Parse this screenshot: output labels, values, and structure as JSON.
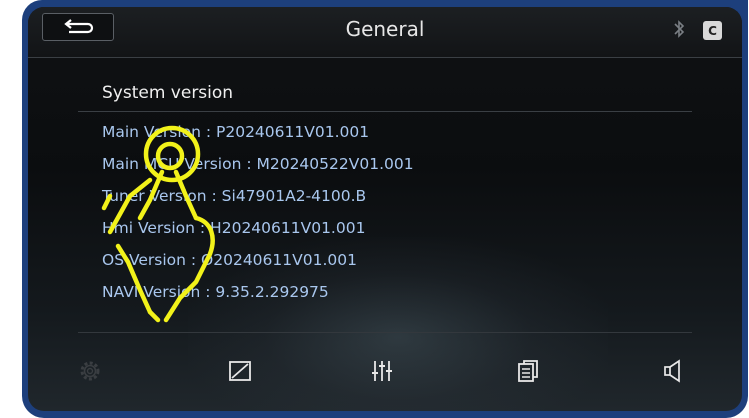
{
  "header": {
    "title": "General",
    "back_icon": "back-arrow-icon",
    "status_icons": [
      "bluetooth-icon",
      "c-badge-icon"
    ],
    "c_badge_text": "C"
  },
  "section": {
    "title": "System version"
  },
  "versions": [
    {
      "text": "Main Version : P20240611V01.001"
    },
    {
      "text": "Main MCU Version : M20240522V01.001"
    },
    {
      "text": "Tuner Version : Si47901A2-4100.B"
    },
    {
      "text": "Hmi Version : H20240611V01.001"
    },
    {
      "text": "OS Version : O20240611V01.001"
    },
    {
      "text": "NAVI Version : 9.35.2.292975"
    }
  ],
  "bottom_bar": {
    "items": [
      {
        "icon": "gear-icon",
        "enabled": false
      },
      {
        "icon": "display-icon",
        "enabled": true
      },
      {
        "icon": "equalizer-icon",
        "enabled": true
      },
      {
        "icon": "pages-icon",
        "enabled": true
      },
      {
        "icon": "speaker-icon",
        "enabled": true
      }
    ]
  },
  "overlay": {
    "icon": "tap-gesture-icon",
    "color": "#f2f21a"
  },
  "colors": {
    "frame": "#1d3f7c",
    "version_text": "#a9c7ee",
    "title_text": "#e6e6e6"
  }
}
